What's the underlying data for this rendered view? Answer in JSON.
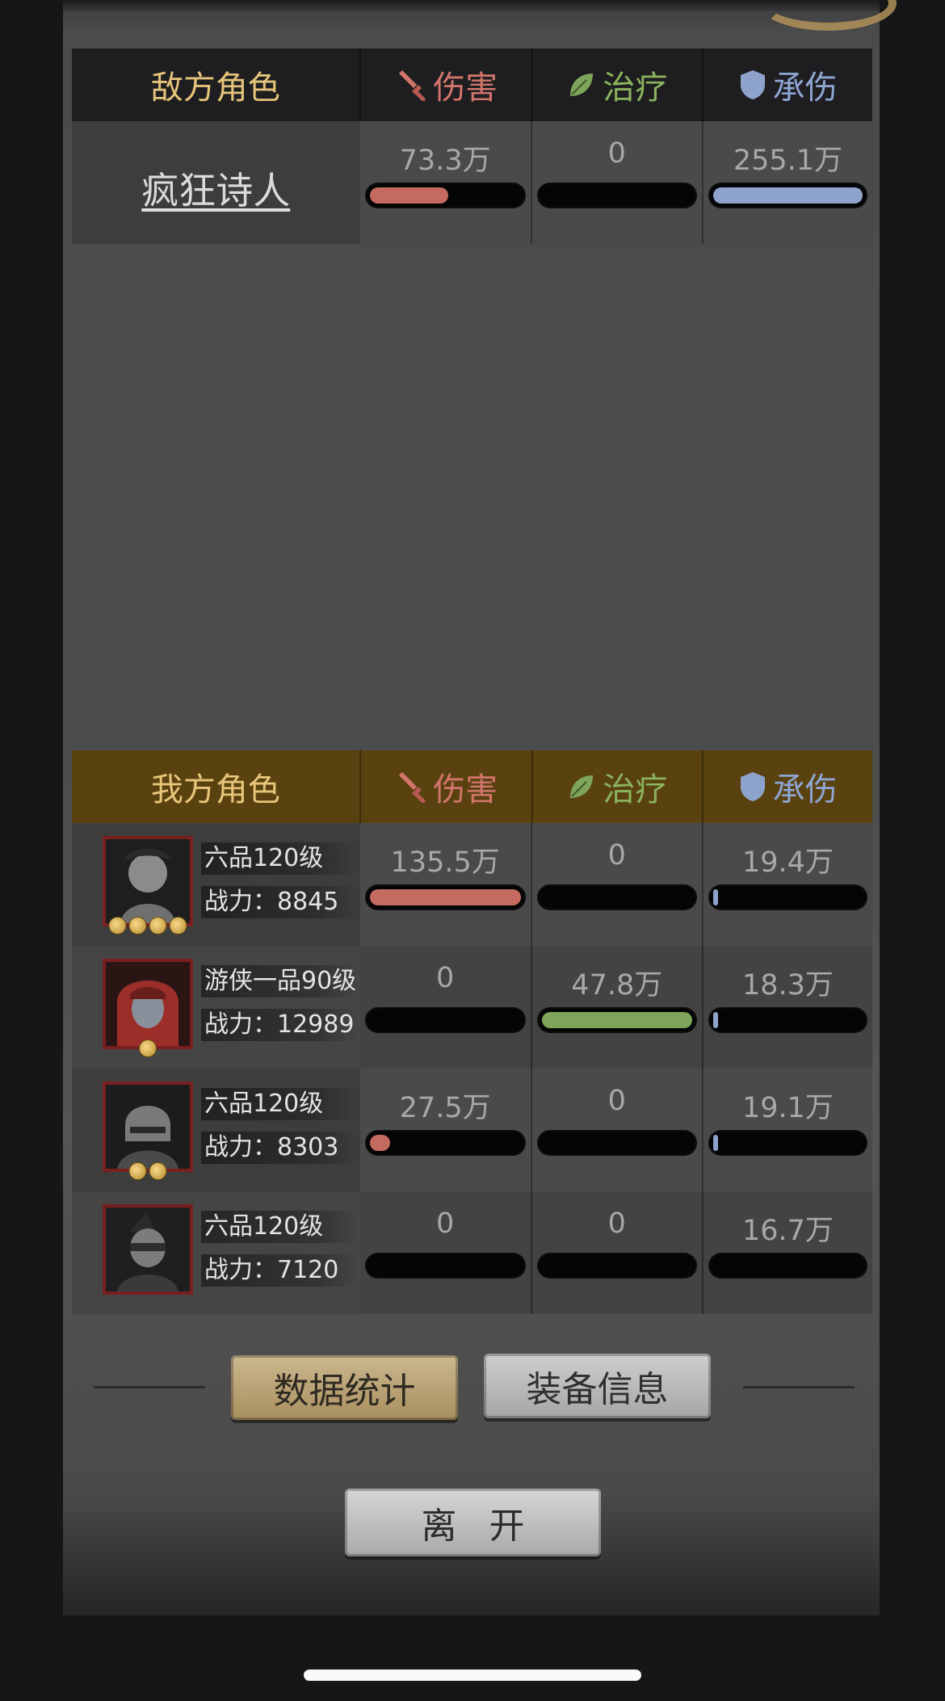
{
  "enemy_table": {
    "header": {
      "title": "敌方角色",
      "damage": "伤害",
      "heal": "治疗",
      "tank": "承伤"
    },
    "rows": [
      {
        "name": "疯狂诗人",
        "damage": "73.3万",
        "heal": "0",
        "tank": "255.1万",
        "damage_fill": 0.54,
        "heal_fill": 0.0,
        "tank_fill": 1.0
      }
    ]
  },
  "ally_table": {
    "header": {
      "title": "我方角色",
      "damage": "伤害",
      "heal": "治疗",
      "tank": "承伤"
    },
    "rows": [
      {
        "rank": "六品120级",
        "power": "战力：8845",
        "stars": 4,
        "damage": "135.5万",
        "heal": "0",
        "tank": "19.4万",
        "damage_fill": 1.0,
        "heal_fill": 0.0,
        "tank_fill": 0.02
      },
      {
        "rank": "游侠一品90级",
        "power": "战力：12989",
        "stars": 1,
        "damage": "0",
        "heal": "47.8万",
        "tank": "18.3万",
        "damage_fill": 0.0,
        "heal_fill": 1.0,
        "tank_fill": 0.02
      },
      {
        "rank": "六品120级",
        "power": "战力：8303",
        "stars": 2,
        "damage": "27.5万",
        "heal": "0",
        "tank": "19.1万",
        "damage_fill": 0.17,
        "heal_fill": 0.0,
        "tank_fill": 0.02
      },
      {
        "rank": "六品120级",
        "power": "战力：7120",
        "stars": 0,
        "damage": "0",
        "heal": "0",
        "tank": "16.7万",
        "damage_fill": 0.0,
        "heal_fill": 0.0,
        "tank_fill": 0.0
      }
    ]
  },
  "buttons": {
    "stats": "数据统计",
    "equip": "装备信息",
    "leave": "离开"
  },
  "icons": {
    "damage": "sword-icon",
    "heal": "leaf-icon",
    "tank": "shield-icon"
  },
  "colors": {
    "damage": "#c46a60",
    "heal": "#7ea55a",
    "tank": "#8ea3cc",
    "ally_header": "#5a4210",
    "enemy_header": "#1e1e20"
  }
}
